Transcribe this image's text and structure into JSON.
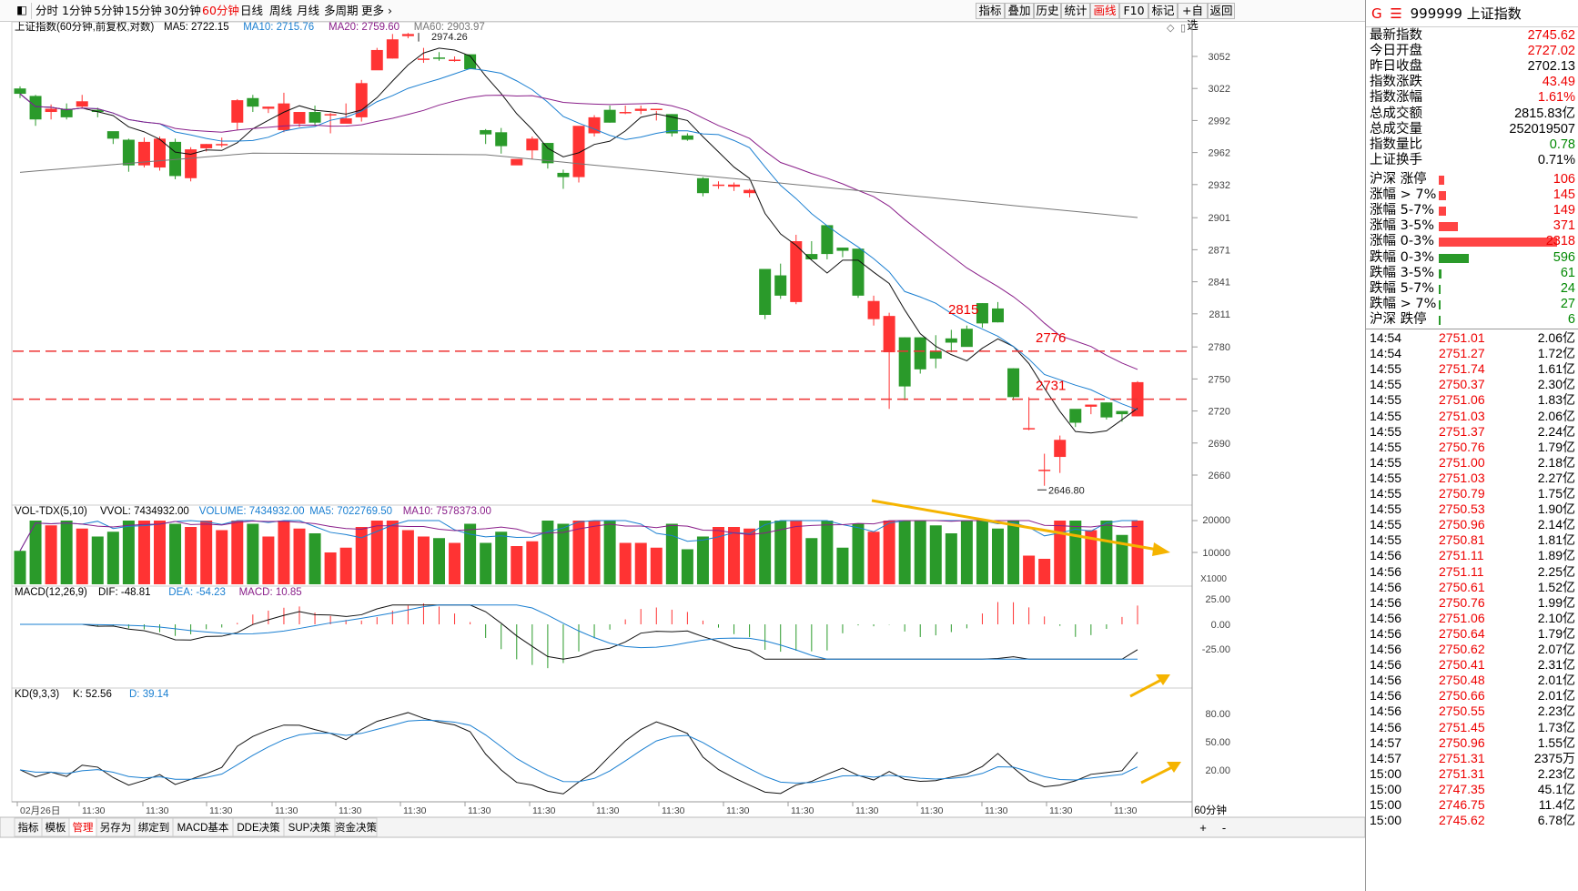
{
  "toolbar": {
    "periods": [
      "分时",
      "1分钟",
      "5分钟",
      "15分钟",
      "30分钟",
      "60分钟",
      "日线",
      "周线",
      "月线",
      "多周期",
      "更多"
    ],
    "active_period": "60分钟",
    "right_buttons": [
      "指标",
      "叠加",
      "历史",
      "统计",
      "画线",
      "F10",
      "标记",
      "+自选",
      "返回"
    ],
    "active_right": "画线"
  },
  "main": {
    "title": "上证指数(60分钟,前复权,对数)",
    "ma": [
      {
        "label": "MA5: 2722.15",
        "color": "#000000"
      },
      {
        "label": "MA10: 2715.76",
        "color": "#1a7fd1"
      },
      {
        "label": "MA20: 2759.60",
        "color": "#8a1f8a"
      },
      {
        "label": "MA60: 2903.97",
        "color": "#777777"
      }
    ],
    "y_ticks": [
      3052,
      3022,
      2992,
      2962,
      2932,
      2901,
      2871,
      2841,
      2811,
      2780,
      2750,
      2720,
      2690,
      2660
    ],
    "annotations": [
      {
        "text": "2974.26"
      },
      {
        "text": "2646.80"
      },
      {
        "text": "2815"
      },
      {
        "text": "2776"
      },
      {
        "text": "2731"
      }
    ],
    "h_lines": [
      2776,
      2731
    ]
  },
  "vol": {
    "title": "VOL-TDX(5,10)",
    "labels": [
      {
        "text": "VVOL: 7434932.00",
        "color": "#000000"
      },
      {
        "text": "VOLUME: 7434932.00",
        "color": "#1a7fd1"
      },
      {
        "text": "MA5: 7022769.50",
        "color": "#1a7fd1"
      },
      {
        "text": "MA10: 7578373.00",
        "color": "#8a1f8a"
      }
    ],
    "ticks": [
      "20000",
      "10000"
    ],
    "unit": "X1000"
  },
  "macd": {
    "title": "MACD(12,26,9)",
    "labels": [
      {
        "text": "DIF: -48.81",
        "color": "#000000"
      },
      {
        "text": "DEA: -54.23",
        "color": "#1a7fd1"
      },
      {
        "text": "MACD: 10.85",
        "color": "#8a1f8a"
      }
    ],
    "ticks": [
      "25.00",
      "0.00",
      "-25.00"
    ]
  },
  "kd": {
    "title": "KD(9,3,3)",
    "labels": [
      {
        "text": "K: 52.56",
        "color": "#000000"
      },
      {
        "text": "D: 39.14",
        "color": "#1a7fd1"
      }
    ],
    "ticks": [
      "80.00",
      "50.00",
      "20.00"
    ]
  },
  "xaxis": {
    "labels": [
      "02月26日",
      "11:30",
      "11:30",
      "11:30",
      "11:30",
      "11:30",
      "11:30",
      "11:30",
      "11:30",
      "11:30",
      "11:30",
      "11:30",
      "11:30",
      "11:30",
      "11:30",
      "11:30",
      "11:30",
      "11:30"
    ],
    "period": "60分钟"
  },
  "bottom_tabs": [
    "指标",
    "模板",
    "管理",
    "另存为",
    "绑定到",
    "MACD基本",
    "DDE决策",
    "SUP决策",
    "资金决策"
  ],
  "active_bottom_tab": "管理",
  "bottom_buttons": [
    "+",
    "-"
  ],
  "side": {
    "code": "999999",
    "name": "上证指数",
    "marker": "G",
    "quote": [
      {
        "label": "最新指数",
        "value": "2745.62",
        "color": "red"
      },
      {
        "label": "今日开盘",
        "value": "2727.02",
        "color": "red"
      },
      {
        "label": "昨日收盘",
        "value": "2702.13",
        "color": "black"
      },
      {
        "label": "指数涨跌",
        "value": "43.49",
        "color": "red"
      },
      {
        "label": "指数涨幅",
        "value": "1.61%",
        "color": "red"
      },
      {
        "label": "总成交额",
        "value": "2815.83亿",
        "color": "black"
      },
      {
        "label": "总成交量",
        "value": "252019507",
        "color": "black"
      },
      {
        "label": "指数量比",
        "value": "0.78",
        "color": "green"
      },
      {
        "label": "上证换手",
        "value": "0.71%",
        "color": "black"
      }
    ],
    "dist": [
      {
        "label": "沪深 涨停",
        "value": "106",
        "color": "red"
      },
      {
        "label": "涨幅 > 7%",
        "value": "145",
        "color": "red"
      },
      {
        "label": "涨幅 5-7%",
        "value": "149",
        "color": "red"
      },
      {
        "label": "涨幅 3-5%",
        "value": "371",
        "color": "red"
      },
      {
        "label": "涨幅 0-3%",
        "value": "2318",
        "color": "red"
      },
      {
        "label": "跌幅 0-3%",
        "value": "596",
        "color": "green"
      },
      {
        "label": "跌幅 3-5%",
        "value": "61",
        "color": "green"
      },
      {
        "label": "跌幅 5-7%",
        "value": "24",
        "color": "green"
      },
      {
        "label": "跌幅 > 7%",
        "value": "27",
        "color": "green"
      },
      {
        "label": "沪深 跌停",
        "value": "6",
        "color": "green"
      }
    ],
    "ticks": [
      [
        "14:54",
        "2751.01",
        "2.06亿"
      ],
      [
        "14:54",
        "2751.27",
        "1.72亿"
      ],
      [
        "14:55",
        "2751.74",
        "1.61亿"
      ],
      [
        "14:55",
        "2750.37",
        "2.30亿"
      ],
      [
        "14:55",
        "2751.06",
        "1.83亿"
      ],
      [
        "14:55",
        "2751.03",
        "2.06亿"
      ],
      [
        "14:55",
        "2751.37",
        "2.24亿"
      ],
      [
        "14:55",
        "2750.76",
        "1.79亿"
      ],
      [
        "14:55",
        "2751.00",
        "2.18亿"
      ],
      [
        "14:55",
        "2751.03",
        "2.27亿"
      ],
      [
        "14:55",
        "2750.79",
        "1.75亿"
      ],
      [
        "14:55",
        "2750.53",
        "1.90亿"
      ],
      [
        "14:55",
        "2750.96",
        "2.14亿"
      ],
      [
        "14:55",
        "2750.81",
        "1.81亿"
      ],
      [
        "14:56",
        "2751.11",
        "1.89亿"
      ],
      [
        "14:56",
        "2751.11",
        "2.25亿"
      ],
      [
        "14:56",
        "2750.61",
        "1.52亿"
      ],
      [
        "14:56",
        "2750.76",
        "1.99亿"
      ],
      [
        "14:56",
        "2751.06",
        "2.10亿"
      ],
      [
        "14:56",
        "2750.64",
        "1.79亿"
      ],
      [
        "14:56",
        "2750.62",
        "2.07亿"
      ],
      [
        "14:56",
        "2750.41",
        "2.31亿"
      ],
      [
        "14:56",
        "2750.48",
        "2.01亿"
      ],
      [
        "14:56",
        "2750.66",
        "2.01亿"
      ],
      [
        "14:56",
        "2750.55",
        "2.23亿"
      ],
      [
        "14:56",
        "2751.45",
        "1.73亿"
      ],
      [
        "14:57",
        "2750.96",
        "1.55亿"
      ],
      [
        "14:57",
        "2751.31",
        "2375万"
      ],
      [
        "15:00",
        "2751.31",
        "2.23亿"
      ],
      [
        "15:00",
        "2747.35",
        "45.1亿"
      ],
      [
        "15:00",
        "2746.75",
        "11.4亿"
      ],
      [
        "15:00",
        "2745.62",
        "6.78亿"
      ]
    ]
  },
  "chart_data": {
    "type": "candlestick",
    "candles": [
      [
        3022,
        3017,
        3024,
        3013
      ],
      [
        3015,
        2993,
        3016,
        2987
      ],
      [
        3000,
        3003,
        3007,
        2993
      ],
      [
        3003,
        2995,
        3008,
        2993
      ],
      [
        3005,
        3010,
        3016,
        3004
      ],
      [
        3002,
        3000,
        3004,
        2995
      ],
      [
        2982,
        2975,
        2980,
        2970
      ],
      [
        2974,
        2950,
        2975,
        2944
      ],
      [
        2950,
        2972,
        2976,
        2948
      ],
      [
        2948,
        2975,
        2977,
        2945
      ],
      [
        2972,
        2940,
        2975,
        2937
      ],
      [
        2938,
        2965,
        2967,
        2935
      ],
      [
        2966,
        2970,
        2970,
        2963
      ],
      [
        2970,
        2970,
        2976,
        2967
      ],
      [
        2990,
        3011,
        3012,
        2983
      ],
      [
        3013,
        3005,
        3016,
        3000
      ],
      [
        3003,
        3005,
        3005,
        2999
      ],
      [
        2983,
        3008,
        3018,
        2981
      ],
      [
        2989,
        3000,
        3000,
        2986
      ],
      [
        3000,
        2990,
        3006,
        2987
      ],
      [
        2998,
        2998,
        2999,
        2980
      ],
      [
        2989,
        2994,
        3008,
        2990
      ],
      [
        2995,
        3027,
        3030,
        2991
      ],
      [
        3039,
        3058,
        3060,
        3040
      ],
      [
        3050,
        3068,
        3073,
        3050
      ],
      [
        3071,
        3073,
        3074,
        3069
      ],
      [
        3050,
        3050,
        3060,
        3046
      ],
      [
        3051,
        3050,
        3056,
        3048
      ],
      [
        3049,
        3049,
        3052,
        3047
      ],
      [
        3054,
        3040,
        3053,
        3042
      ],
      [
        2983,
        2979,
        2984,
        2970
      ],
      [
        2981,
        2968,
        2985,
        2961
      ],
      [
        2950,
        2956,
        2951,
        2955
      ],
      [
        2964,
        2975,
        2977,
        2956
      ],
      [
        2971,
        2952,
        2971,
        2947
      ],
      [
        2943,
        2939,
        2946,
        2928
      ],
      [
        2939,
        2987,
        2977,
        2934
      ],
      [
        2980,
        2995,
        2997,
        2977
      ],
      [
        3002,
        2990,
        3006,
        2990
      ],
      [
        3000,
        3000,
        3006,
        2998
      ],
      [
        3001,
        3003,
        3006,
        2998
      ],
      [
        3002,
        3003,
        3001,
        2992
      ],
      [
        2998,
        2980,
        2998,
        2977
      ],
      [
        2978,
        2974,
        2980,
        2973
      ],
      [
        2938,
        2924,
        2939,
        2921
      ],
      [
        2932,
        2932,
        2935,
        2928
      ],
      [
        2930,
        2932,
        2934,
        2926
      ],
      [
        2924,
        2927,
        2928,
        2920
      ],
      [
        2853,
        2810,
        2850,
        2806
      ],
      [
        2847,
        2828,
        2858,
        2825
      ],
      [
        2822,
        2879,
        2885,
        2820
      ],
      [
        2867,
        2862,
        2879,
        2862
      ],
      [
        2894,
        2867,
        2893,
        2862
      ],
      [
        2873,
        2870,
        2873,
        2864
      ],
      [
        2872,
        2828,
        2871,
        2826
      ],
      [
        2806,
        2823,
        2828,
        2800
      ],
      [
        2775,
        2809,
        2812,
        2722
      ],
      [
        2789,
        2743,
        2789,
        2730
      ],
      [
        2789,
        2759,
        2789,
        2755
      ],
      [
        2776,
        2769,
        2791,
        2760
      ],
      [
        2788,
        2784,
        2796,
        2775
      ],
      [
        2797,
        2780,
        2800,
        2787
      ],
      [
        2821,
        2802,
        2821,
        2798
      ],
      [
        2816,
        2803,
        2822,
        2803
      ],
      [
        2760,
        2733,
        2760,
        2730
      ],
      [
        2704,
        2704,
        2733,
        2702
      ],
      [
        2665,
        2665,
        2680,
        2650
      ],
      [
        2677,
        2693,
        2697,
        2662
      ],
      [
        2722,
        2709,
        2711,
        2705
      ],
      [
        2724,
        2726,
        2726,
        2717
      ],
      [
        2728,
        2714,
        2728,
        2712
      ],
      [
        2720,
        2717,
        2719,
        2710
      ],
      [
        2715,
        2747,
        2748,
        2715
      ]
    ]
  }
}
